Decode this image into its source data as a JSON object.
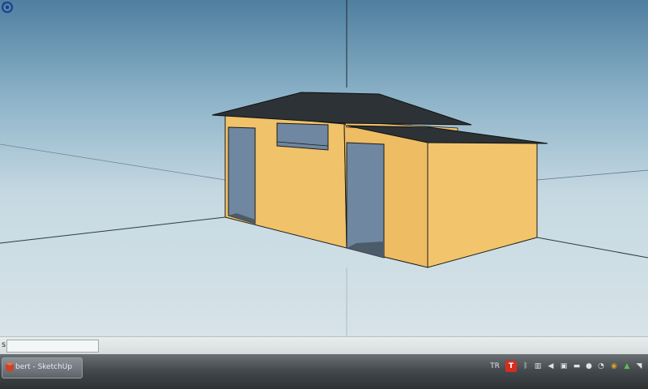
{
  "viewport": {
    "description_free": true,
    "colors": {
      "wall": "#f0c26a",
      "wall_shadow": "#e7b65c",
      "roof": "#2c3236",
      "opening": "#6f87a0",
      "edge": "#1d1d1d"
    }
  },
  "statusbar": {
    "measurements_label": "s",
    "measurements_value": ""
  },
  "taskbar": {
    "app_button_label": "bert - SketchUp",
    "tray": {
      "language": "TR",
      "icons": [
        "t-app-icon",
        "bluetooth-icon",
        "network-icon",
        "volume-icon",
        "monitor-icon",
        "power-icon",
        "notification-icon",
        "security-icon",
        "update-icon",
        "sync-icon"
      ]
    }
  }
}
